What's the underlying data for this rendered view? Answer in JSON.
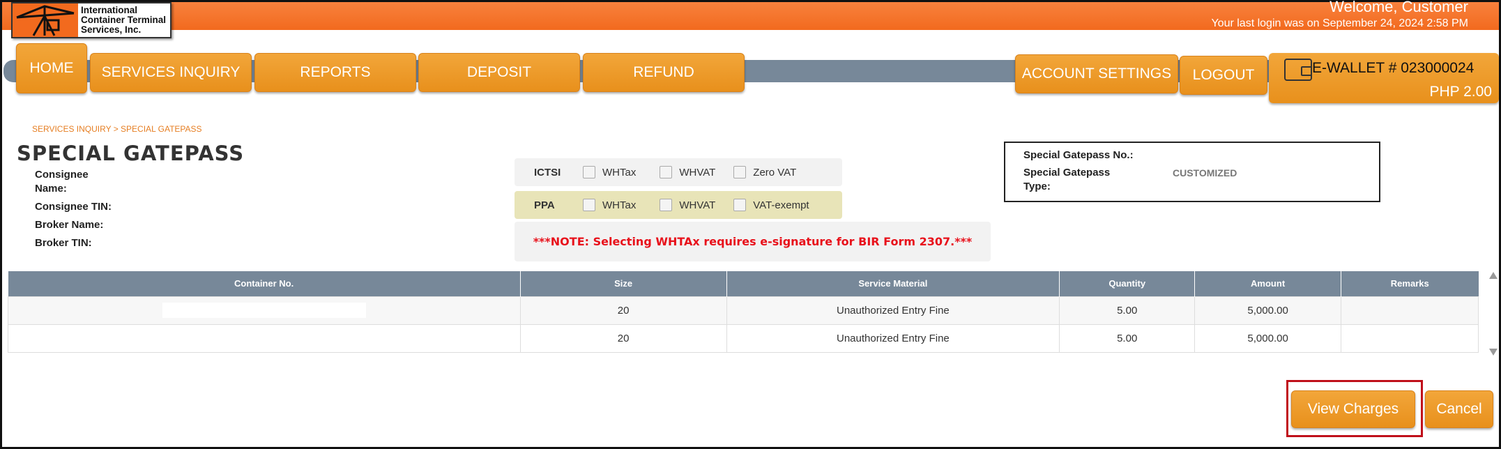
{
  "header": {
    "logo_text": [
      "International",
      "Container Terminal",
      "Services, Inc."
    ],
    "welcome": "Welcome, Customer",
    "last_login": "Your last login was on September 24, 2024 2:58 PM"
  },
  "nav": {
    "home": "HOME",
    "services_inquiry": "SERVICES INQUIRY",
    "reports": "REPORTS",
    "deposit": "DEPOSIT",
    "refund": "REFUND",
    "account_settings": "ACCOUNT SETTINGS",
    "logout": "LOGOUT"
  },
  "wallet": {
    "number": "E-WALLET # 023000024",
    "balance": "PHP 2.00"
  },
  "breadcrumb": "SERVICES INQUIRY > SPECIAL GATEPASS",
  "page_title": "SPECIAL GATEPASS",
  "form": {
    "consignee_name_line1": "Consignee",
    "consignee_name_line2": "Name:",
    "consignee_tin": "Consignee TIN:",
    "broker_name": "Broker Name:",
    "broker_tin": "Broker TIN:"
  },
  "tax": {
    "ictsi_label": "ICTSI",
    "ictsi_options": [
      "WHTax",
      "WHVAT",
      "Zero VAT"
    ],
    "ppa_label": "PPA",
    "ppa_options": [
      "WHTax",
      "WHVAT",
      "VAT-exempt"
    ],
    "note": "***NOTE: Selecting WHTAx requires e-signature for BIR Form 2307.***"
  },
  "gatepass": {
    "number_label": "Special Gatepass No.:",
    "number_value": "",
    "type_label_line1": "Special Gatepass",
    "type_label_line2": "Type:",
    "type_value": "CUSTOMIZED"
  },
  "table": {
    "headers": [
      "Container No.",
      "Size",
      "Service Material",
      "Quantity",
      "Amount",
      "Remarks"
    ],
    "rows": [
      {
        "container": "",
        "size": "20",
        "material": "Unauthorized Entry Fine",
        "quantity": "5.00",
        "amount": "5,000.00",
        "remarks": ""
      },
      {
        "container": "",
        "size": "20",
        "material": "Unauthorized Entry Fine",
        "quantity": "5.00",
        "amount": "5,000.00",
        "remarks": ""
      }
    ]
  },
  "actions": {
    "view_charges": "View Charges",
    "cancel": "Cancel"
  },
  "colors": {
    "accent_orange": "#f26a1e",
    "button_orange": "#eb9a2a",
    "nav_gray": "#778899",
    "note_red": "#e8111b",
    "highlight_red": "#c0101a"
  }
}
